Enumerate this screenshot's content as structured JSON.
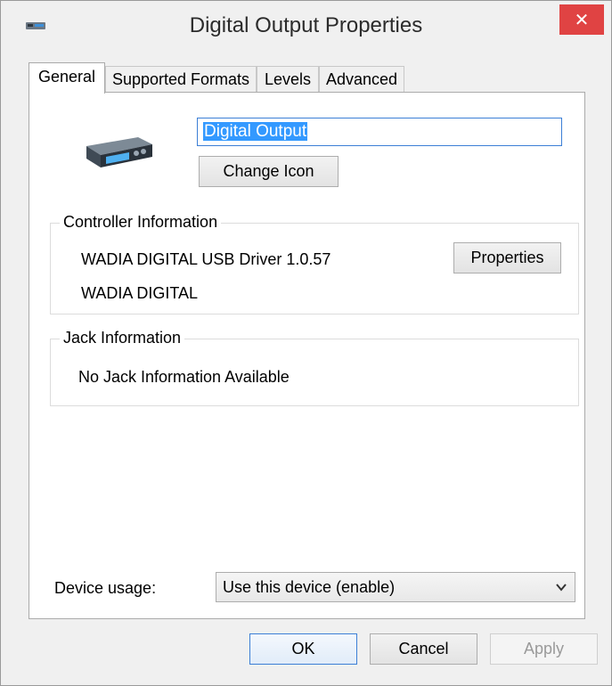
{
  "window": {
    "title": "Digital Output Properties",
    "close_glyph": "✕"
  },
  "tabs": [
    {
      "label": "General",
      "active": true
    },
    {
      "label": "Supported Formats",
      "active": false
    },
    {
      "label": "Levels",
      "active": false
    },
    {
      "label": "Advanced",
      "active": false
    }
  ],
  "general": {
    "device_name": "Digital Output",
    "change_icon_label": "Change Icon",
    "controller": {
      "title": "Controller Information",
      "driver": "WADIA DIGITAL USB Driver 1.0.57",
      "manufacturer": "WADIA DIGITAL",
      "properties_label": "Properties"
    },
    "jack": {
      "title": "Jack Information",
      "text": "No Jack Information Available"
    },
    "device_usage": {
      "label": "Device usage:",
      "selected": "Use this device (enable)"
    }
  },
  "footer": {
    "ok_label": "OK",
    "cancel_label": "Cancel",
    "apply_label": "Apply"
  },
  "colors": {
    "close_button": "#e04343",
    "selection": "#3399ff",
    "focus_border": "#3c7fd6"
  }
}
